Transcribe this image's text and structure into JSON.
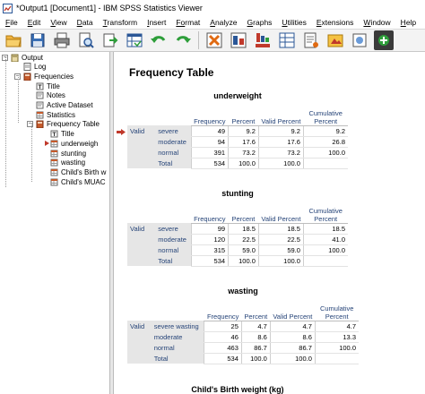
{
  "window": {
    "title": "*Output1 [Document1] - IBM SPSS Statistics Viewer"
  },
  "menu": [
    {
      "key": "F",
      "rest": "ile"
    },
    {
      "key": "E",
      "rest": "dit"
    },
    {
      "key": "V",
      "rest": "iew"
    },
    {
      "key": "D",
      "rest": "ata"
    },
    {
      "key": "T",
      "rest": "ransform"
    },
    {
      "key": "I",
      "rest": "nsert"
    },
    {
      "key": "Fo",
      "rest": "rmat"
    },
    {
      "key": "A",
      "rest": "nalyze"
    },
    {
      "key": "G",
      "rest": "raphs"
    },
    {
      "key": "U",
      "rest": "tilities"
    },
    {
      "key": "E",
      "rest": "xtensions"
    },
    {
      "key": "W",
      "rest": "indow"
    },
    {
      "key": "H",
      "rest": "elp"
    }
  ],
  "toolbar": {
    "icons": [
      "open-folder-icon",
      "save-icon",
      "print-icon",
      "print-preview-icon",
      "export-icon",
      "goto-data-icon",
      "undo-icon",
      "redo-icon",
      "goto-case-icon",
      "goto-variable-icon",
      "variables-icon",
      "insert-chart-icon",
      "insert-text-icon",
      "designated-window-icon",
      "show-all-icon",
      "insert-output-icon"
    ]
  },
  "outline": {
    "items": [
      {
        "label": "Output",
        "level": 0,
        "icon": "log-book-icon",
        "expander": "-"
      },
      {
        "label": "Log",
        "level": 1,
        "icon": "log-page-icon",
        "expander": ""
      },
      {
        "label": "Frequencies",
        "level": 1,
        "icon": "procedure-book-icon",
        "expander": "-"
      },
      {
        "label": "Title",
        "level": 2,
        "icon": "title-icon",
        "expander": ""
      },
      {
        "label": "Notes",
        "level": 2,
        "icon": "notes-icon",
        "expander": ""
      },
      {
        "label": "Active Dataset",
        "level": 2,
        "icon": "notes-icon",
        "expander": ""
      },
      {
        "label": "Statistics",
        "level": 2,
        "icon": "table-icon",
        "expander": ""
      },
      {
        "label": "Frequency Table",
        "level": 2,
        "icon": "procedure-book-icon",
        "expander": "-"
      },
      {
        "label": "Title",
        "level": 3,
        "icon": "title-icon",
        "expander": ""
      },
      {
        "label": "underweigh",
        "level": 3,
        "icon": "table-icon",
        "expander": "",
        "selected_arrow": true
      },
      {
        "label": "stunting",
        "level": 3,
        "icon": "table-icon",
        "expander": ""
      },
      {
        "label": "wasting",
        "level": 3,
        "icon": "table-icon",
        "expander": ""
      },
      {
        "label": "Child's Birth w",
        "level": 3,
        "icon": "table-icon",
        "expander": ""
      },
      {
        "label": "Child's MUAC",
        "level": 3,
        "icon": "table-icon",
        "expander": ""
      }
    ]
  },
  "content": {
    "heading": "Frequency Table",
    "columns": [
      "Frequency",
      "Percent",
      "Valid Percent",
      "Cumulative Percent"
    ],
    "tables": [
      {
        "title": "underweight",
        "group": "Valid",
        "rows": [
          {
            "label": "severe",
            "freq": "49",
            "pct": "9.2",
            "vpct": "9.2",
            "cum": "9.2"
          },
          {
            "label": "moderate",
            "freq": "94",
            "pct": "17.6",
            "vpct": "17.6",
            "cum": "26.8"
          },
          {
            "label": "normal",
            "freq": "391",
            "pct": "73.2",
            "vpct": "73.2",
            "cum": "100.0"
          },
          {
            "label": "Total",
            "freq": "534",
            "pct": "100.0",
            "vpct": "100.0",
            "cum": ""
          }
        ]
      },
      {
        "title": "stunting",
        "group": "Valid",
        "rows": [
          {
            "label": "severe",
            "freq": "99",
            "pct": "18.5",
            "vpct": "18.5",
            "cum": "18.5"
          },
          {
            "label": "moderate",
            "freq": "120",
            "pct": "22.5",
            "vpct": "22.5",
            "cum": "41.0"
          },
          {
            "label": "normal",
            "freq": "315",
            "pct": "59.0",
            "vpct": "59.0",
            "cum": "100.0"
          },
          {
            "label": "Total",
            "freq": "534",
            "pct": "100.0",
            "vpct": "100.0",
            "cum": ""
          }
        ]
      },
      {
        "title": "wasting",
        "group": "Valid",
        "rows": [
          {
            "label": "severe wasting",
            "freq": "25",
            "pct": "4.7",
            "vpct": "4.7",
            "cum": "4.7"
          },
          {
            "label": "moderate",
            "freq": "46",
            "pct": "8.6",
            "vpct": "8.6",
            "cum": "13.3"
          },
          {
            "label": "normal",
            "freq": "463",
            "pct": "86.7",
            "vpct": "86.7",
            "cum": "100.0"
          },
          {
            "label": "Total",
            "freq": "534",
            "pct": "100.0",
            "vpct": "100.0",
            "cum": ""
          }
        ]
      }
    ],
    "next_title": "Child's Birth weight (kg)"
  }
}
